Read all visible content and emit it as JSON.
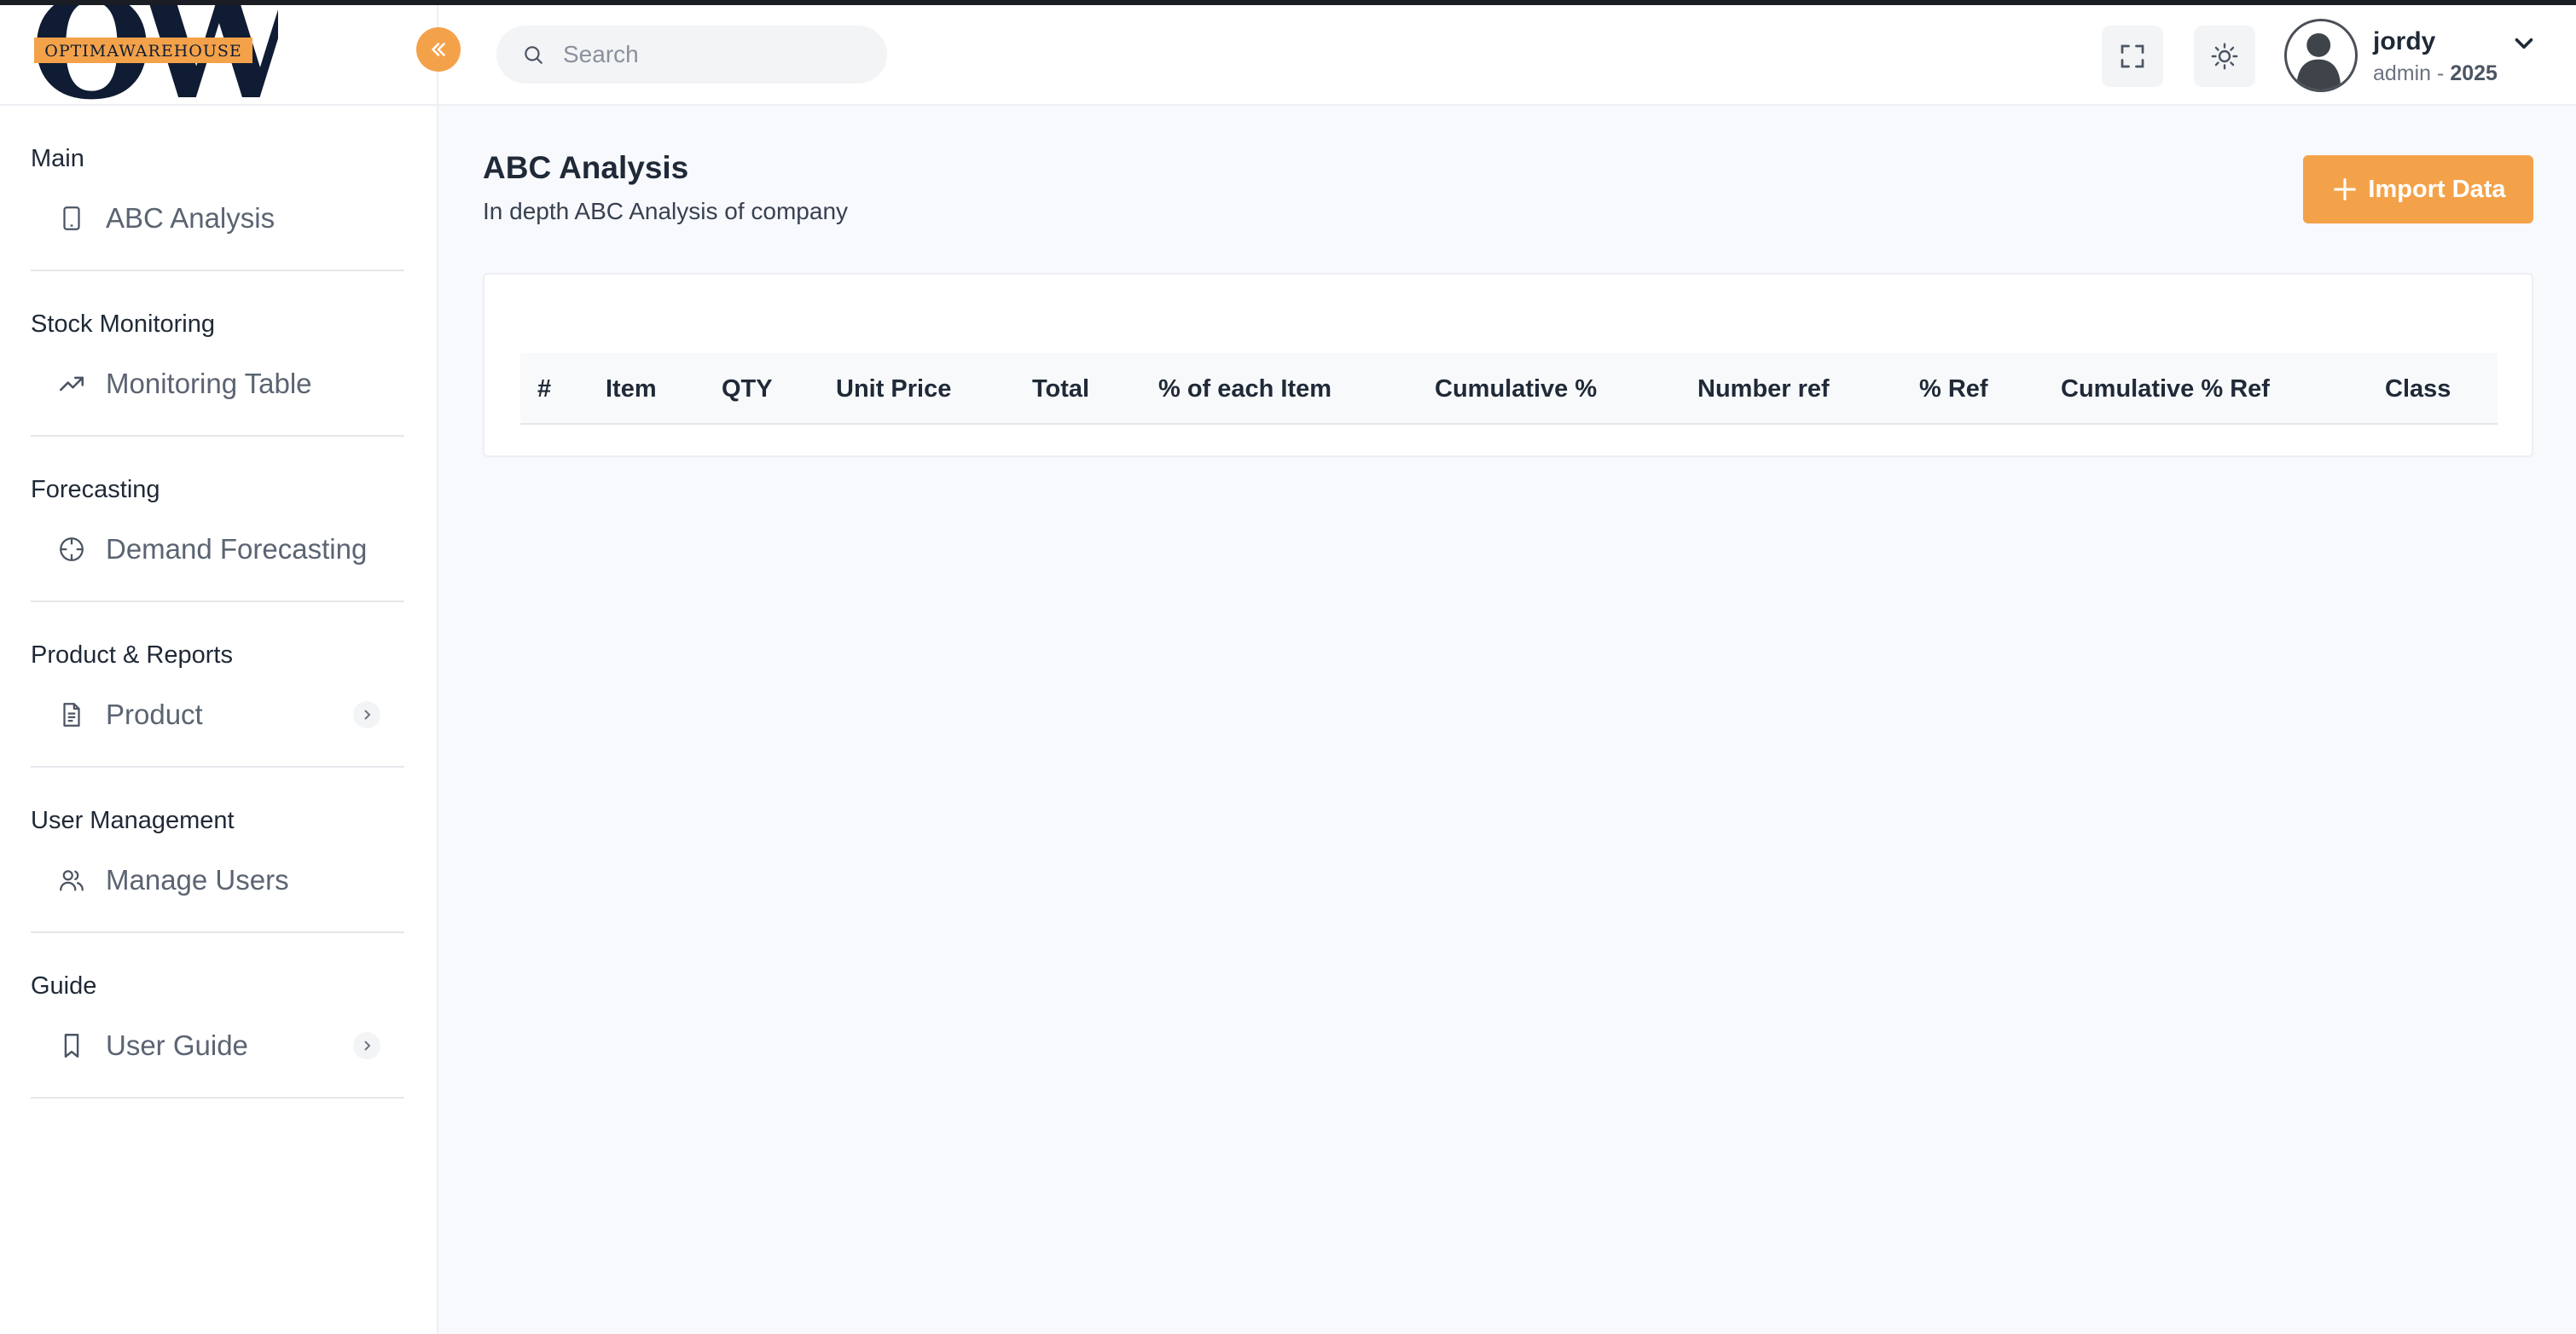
{
  "brand": {
    "logo_letters": "OW",
    "logo_text": "OPTIMAWAREHOUSE",
    "accent": "#f4a24a",
    "dark": "#0f1c33"
  },
  "sidebar": {
    "sections": [
      {
        "title": "Main",
        "item": {
          "label": "ABC Analysis",
          "icon": "tablet-icon",
          "has_chevron": false
        }
      },
      {
        "title": "Stock Monitoring",
        "item": {
          "label": "Monitoring Table",
          "icon": "trending-up-icon",
          "has_chevron": false
        }
      },
      {
        "title": "Forecasting",
        "item": {
          "label": "Demand Forecasting",
          "icon": "crosshair-icon",
          "has_chevron": false
        }
      },
      {
        "title": "Product & Reports",
        "item": {
          "label": "Product",
          "icon": "document-icon",
          "has_chevron": true
        }
      },
      {
        "title": "User Management",
        "item": {
          "label": "Manage Users",
          "icon": "users-icon",
          "has_chevron": false
        }
      },
      {
        "title": "Guide",
        "item": {
          "label": "User Guide",
          "icon": "bookmark-icon",
          "has_chevron": true
        }
      }
    ]
  },
  "header": {
    "search": {
      "placeholder": "Search",
      "value": ""
    },
    "user": {
      "name": "jordy",
      "role": "admin - ",
      "year": "2025"
    }
  },
  "main": {
    "title": "ABC Analysis",
    "subtitle": "In depth ABC Analysis of company",
    "import_label": "Import Data",
    "table": {
      "columns": [
        "#",
        "Item",
        "QTY",
        "Unit Price",
        "Total",
        "% of each Item",
        "Cumulative %",
        "Number ref",
        "% Ref",
        "Cumulative % Ref",
        "Class"
      ],
      "rows": []
    }
  }
}
